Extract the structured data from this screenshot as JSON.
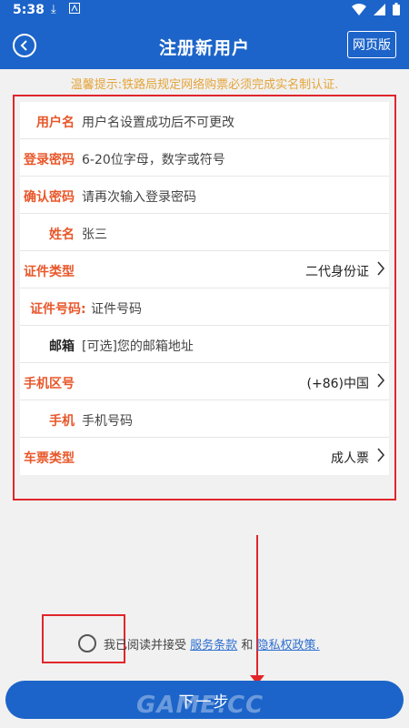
{
  "status": {
    "time": "5:38"
  },
  "header": {
    "title": "注册新用户",
    "web_label": "网页版"
  },
  "notice": "温馨提示:铁路局规定网络购票必须完成实名制认证.",
  "form": {
    "username": {
      "label": "用户名",
      "placeholder": "用户名设置成功后不可更改"
    },
    "password": {
      "label": "登录密码",
      "placeholder": "6-20位字母，数字或符号"
    },
    "confirm": {
      "label": "确认密码",
      "placeholder": "请再次输入登录密码"
    },
    "name": {
      "label": "姓名",
      "value": "张三"
    },
    "id_type": {
      "label": "证件类型",
      "value": "二代身份证"
    },
    "id_number": {
      "label": "证件号码:",
      "placeholder": "证件号码"
    },
    "email": {
      "label": "邮箱",
      "placeholder": "[可选]您的邮箱地址"
    },
    "region": {
      "label": "手机区号",
      "value": "(+86)中国"
    },
    "phone": {
      "label": "手机",
      "placeholder": "手机号码"
    },
    "ticket_type": {
      "label": "车票类型",
      "value": "成人票"
    }
  },
  "agree": {
    "prefix": "我已阅读并接受",
    "terms": "服务条款",
    "and": "和",
    "privacy": "隐私权政策."
  },
  "next_label": "下一步",
  "watermark": "GAME.CC",
  "colors": {
    "primary": "#1c64c9",
    "highlight": "#e0262b",
    "notice": "#e5a53b"
  }
}
